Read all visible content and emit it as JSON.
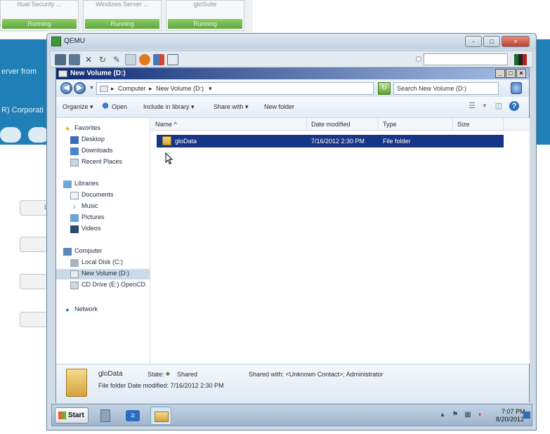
{
  "background": {
    "tabs": [
      {
        "name": "rtual Security ...",
        "status": "Running"
      },
      {
        "name": "Windows Server ...",
        "status": "Running"
      },
      {
        "name": "gloSuite",
        "status": "Running"
      }
    ],
    "band_lines": [
      "erver from",
      "R) Corporati"
    ]
  },
  "qemu": {
    "title": "QEMU",
    "caption": {
      "minimize": "-",
      "maximize": "□",
      "close": "×"
    },
    "toolbar_icons": [
      "monitor-icon",
      "usb-icon",
      "tools-icon",
      "refresh-icon",
      "pencil-icon",
      "print-icon",
      "stop-icon",
      "network-icon",
      "fullscreen-icon"
    ]
  },
  "explorer": {
    "title": "New Volume (D:)",
    "caption": {
      "minimize": "_",
      "maximize": "□",
      "close": "×"
    },
    "breadcrumb": {
      "root": "Computer",
      "current": "New Volume (D:)"
    },
    "search_placeholder": "Search New Volume (D:)",
    "commands": {
      "organize": "Organize ▾",
      "open": "Open",
      "include": "Include in library ▾",
      "share": "Share with ▾",
      "new_folder": "New folder"
    },
    "nav": {
      "favorites": "Favorites",
      "desktop": "Desktop",
      "downloads": "Downloads",
      "recent": "Recent Places",
      "libraries": "Libraries",
      "documents": "Documents",
      "music": "Music",
      "pictures": "Pictures",
      "videos": "Videos",
      "computer": "Computer",
      "local_disk": "Local Disk (C:)",
      "new_volume": "New Volume (D:)",
      "cd_drive": "CD Drive (E:) OpenCD",
      "network": "Network"
    },
    "columns": {
      "name": "Name ^",
      "date": "Date modified",
      "type": "Type",
      "size": "Size"
    },
    "files": [
      {
        "name": "gloData",
        "date": "7/16/2012 2:30 PM",
        "type": "File folder",
        "size": ""
      }
    ],
    "details": {
      "name": "gloData",
      "state_label": "State:",
      "state_value": "Shared",
      "shared_with": "Shared with: <Unknown Contact>; Administrator",
      "type_line": "File folder Date modified: 7/16/2012 2:30 PM"
    }
  },
  "taskbar": {
    "start": "Start",
    "time": "7:07 PM",
    "date": "8/20/2012"
  },
  "colors": {
    "band": "#1f7fb6",
    "selection": "#163584",
    "explorer_title": "#0d2a74"
  }
}
